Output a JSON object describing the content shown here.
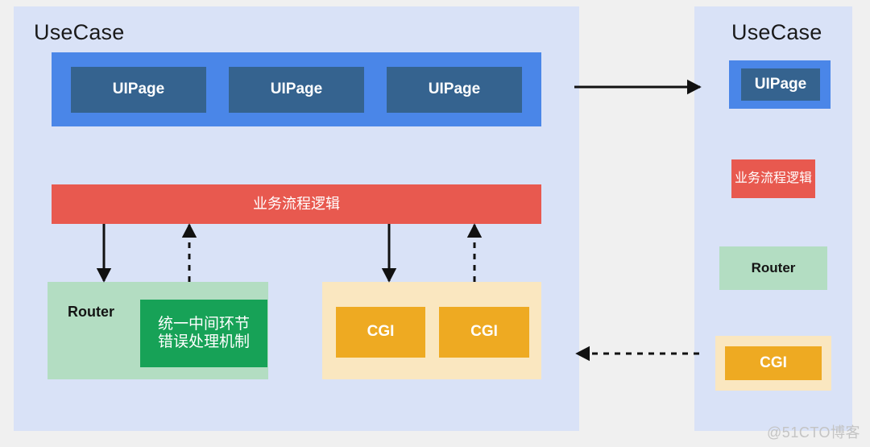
{
  "diagram": {
    "background_color": "#f0f0f0",
    "panel_color": "#d9e2f7",
    "watermark": "@51CTO博客"
  },
  "left_panel": {
    "title": "UseCase",
    "ui_band": {
      "color": "#4a86e8",
      "pages": [
        {
          "label": "UIPage"
        },
        {
          "label": "UIPage"
        },
        {
          "label": "UIPage"
        }
      ],
      "page_color": "#35638f"
    },
    "logic_band": {
      "label": "业务流程逻辑",
      "color": "#e8594f"
    },
    "router_group": {
      "color": "#b3ddc2",
      "label": "Router",
      "inner_box": {
        "color": "#17a257",
        "line1": "统一中间环节",
        "line2": "错误处理机制"
      }
    },
    "cgi_group": {
      "color": "#fae7c0",
      "items": [
        {
          "label": "CGI"
        },
        {
          "label": "CGI"
        }
      ],
      "item_color": "#eeaa22"
    }
  },
  "right_panel": {
    "title": "UseCase",
    "ui_band": {
      "color": "#4a86e8",
      "page": {
        "label": "UIPage",
        "color": "#35638f"
      }
    },
    "logic_band": {
      "label": "业务流程逻辑",
      "color": "#e8594f"
    },
    "router_band": {
      "label": "Router",
      "color": "#b3ddc2"
    },
    "cgi_group": {
      "color": "#fae7c0",
      "item": {
        "label": "CGI",
        "color": "#eeaa22"
      }
    }
  },
  "connectors": {
    "ui_to_ui": {
      "style": "solid",
      "direction": "right"
    },
    "cgi_to_cgi": {
      "style": "dashed",
      "direction": "left"
    },
    "logic_to_router": {
      "style": "solid",
      "direction": "down"
    },
    "router_to_logic": {
      "style": "dashed",
      "direction": "up"
    },
    "logic_to_cgi": {
      "style": "solid",
      "direction": "down"
    },
    "cgi_to_logic": {
      "style": "dashed",
      "direction": "up"
    }
  }
}
